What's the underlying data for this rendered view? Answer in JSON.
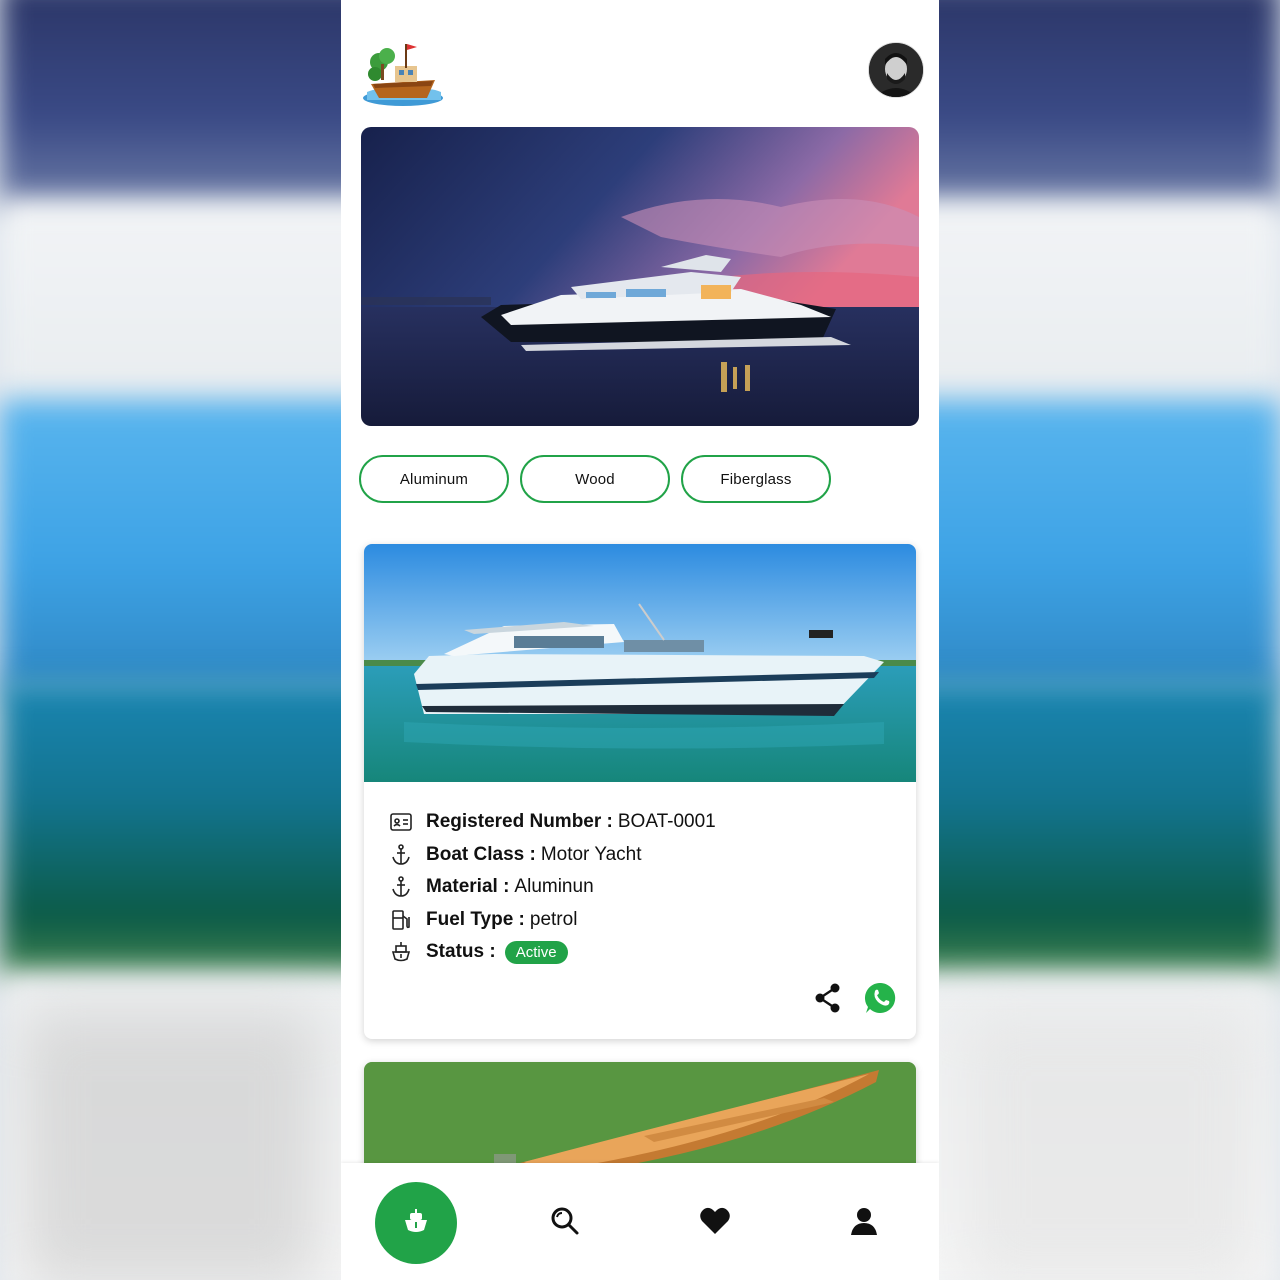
{
  "header": {
    "logo_icon": "boat-island-logo-icon",
    "avatar_icon": "user-avatar"
  },
  "hero": {
    "image": "luxury-yacht-sunset-banner"
  },
  "filters": [
    {
      "label": "Aluminum"
    },
    {
      "label": "Wood"
    },
    {
      "label": "Fiberglass"
    }
  ],
  "listing": {
    "image": "motor-yacht-on-water-photo",
    "fields": [
      {
        "icon": "id-card-icon",
        "key": "Registered Number :",
        "value": "BOAT-0001"
      },
      {
        "icon": "anchor-icon",
        "key": "Boat Class :",
        "value": "Motor Yacht"
      },
      {
        "icon": "anchor-icon",
        "key": "Material :",
        "value": "Aluminun"
      },
      {
        "icon": "fuel-pump-icon",
        "key": "Fuel Type :",
        "value": "petrol"
      },
      {
        "icon": "ship-icon",
        "key": "Status :",
        "value": "Active"
      }
    ],
    "status_color": "#21a348"
  },
  "next_listing": {
    "image": "wooden-canoe-on-grass-photo"
  },
  "bottom_nav": [
    {
      "name": "home",
      "icon": "boat-icon",
      "active": true
    },
    {
      "name": "search",
      "icon": "search-icon"
    },
    {
      "name": "favorites",
      "icon": "heart-icon"
    },
    {
      "name": "profile",
      "icon": "user-icon"
    }
  ],
  "colors": {
    "accent": "#21a348",
    "whatsapp": "#25b34a"
  }
}
